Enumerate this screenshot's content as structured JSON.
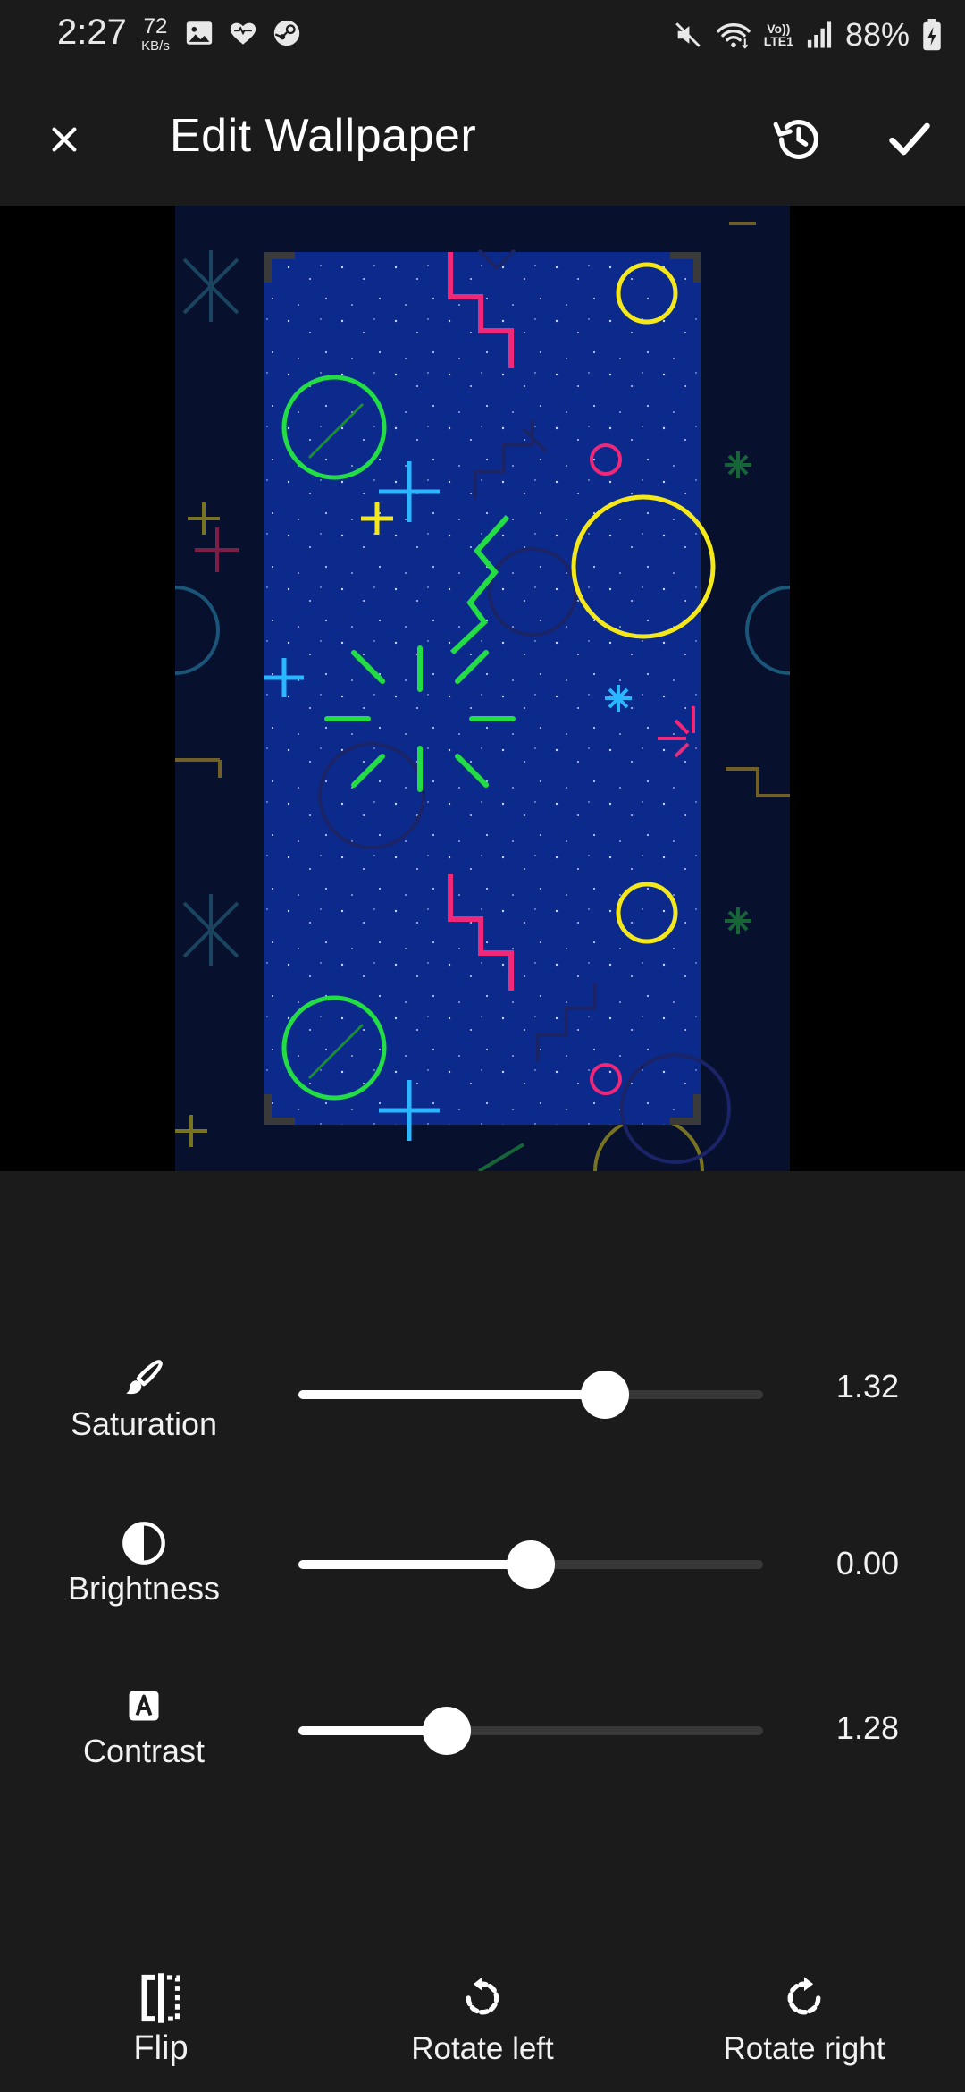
{
  "status_bar": {
    "time": "2:27",
    "net_speed_value": "72",
    "net_speed_unit": "KB/s",
    "left_icons": [
      "image-icon",
      "heart-icon",
      "steam-icon"
    ],
    "right_icons": [
      "mute-icon",
      "wifi-icon",
      "volte-icon",
      "signal-icon",
      "battery-charging-icon"
    ],
    "lte_line1": "Vo))",
    "lte_line2": "LTE1",
    "battery": "88%"
  },
  "appbar": {
    "title": "Edit Wallpaper",
    "close_icon": "close-icon",
    "history_icon": "history-icon",
    "apply_icon": "checkmark-icon"
  },
  "adjustments": [
    {
      "label": "Saturation",
      "icon": "brush-icon",
      "value": "1.32",
      "level": 0.66
    },
    {
      "label": "Brightness",
      "icon": "half-circle-icon",
      "value": "0.00",
      "level": 0.5
    },
    {
      "label": "Contrast",
      "icon": "contrast-a-icon",
      "value": "1.28",
      "level": 0.32
    }
  ],
  "toolbar": {
    "flip_label": "Flip",
    "rotate_left_label": "Rotate left",
    "rotate_right_label": "Rotate right"
  },
  "colors": {
    "background": "#1b1b1b",
    "wallpaper_blue": "#0b2a8c",
    "neon_green": "#22dd44",
    "neon_cyan": "#2ab7ff",
    "neon_yellow": "#f5e81a",
    "neon_pink": "#f0287a"
  }
}
